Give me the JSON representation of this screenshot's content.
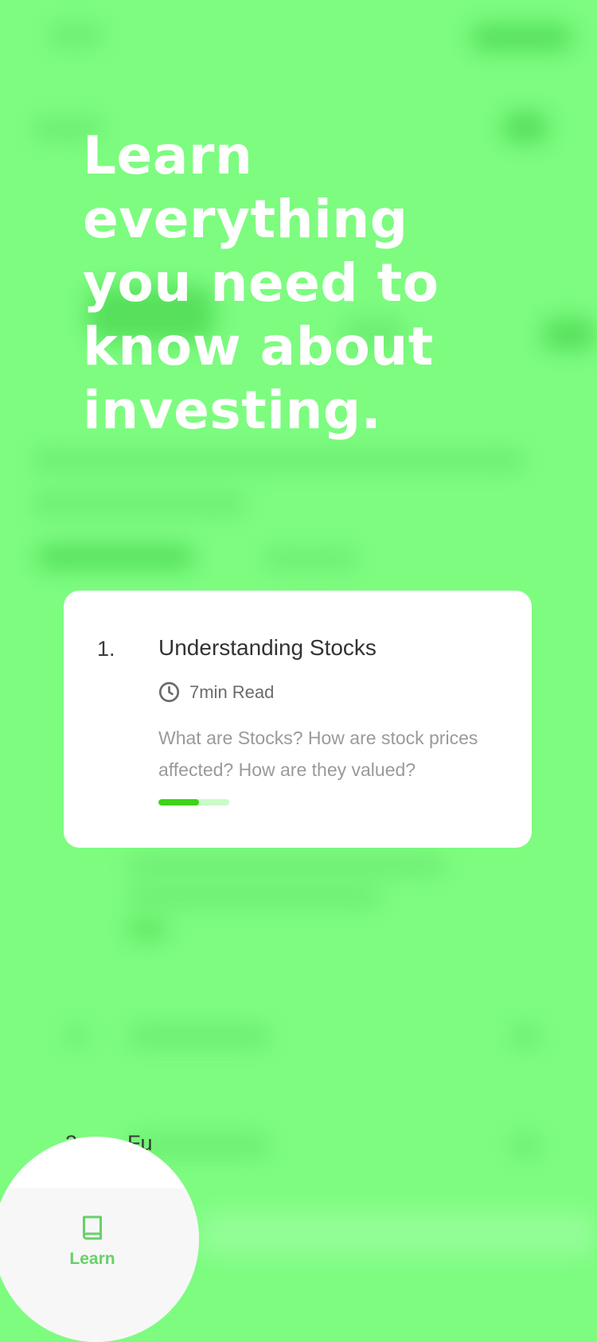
{
  "hero": {
    "headline": "Learn everything you need to know about investing."
  },
  "lesson_card": {
    "number": "1.",
    "title": "Understanding Stocks",
    "read_time": "7min Read",
    "description": "What are Stocks? How are stock prices affected? How are they valued?",
    "progress_fraction": 0.57
  },
  "background_list": {
    "item3_number": "3.",
    "item3_partial_title": "Fu"
  },
  "tab_bar": {
    "learn_label": "Learn"
  },
  "colors": {
    "background": "#7dfc80",
    "accent": "#3ed319",
    "tab_active": "#67d169"
  },
  "icons": {
    "read_time": "clock-icon",
    "learn_tab": "book-icon"
  }
}
